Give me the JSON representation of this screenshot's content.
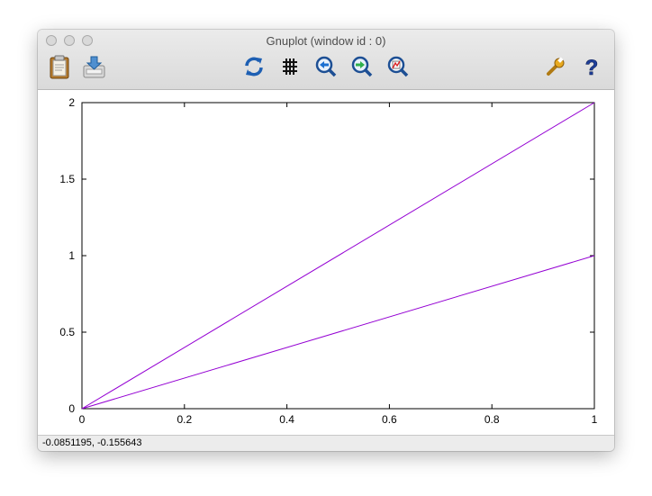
{
  "window": {
    "title": "Gnuplot (window id : 0)"
  },
  "toolbar": {
    "buttons": [
      {
        "name": "copy-to-clipboard-button",
        "icon": "clipboard-icon"
      },
      {
        "name": "export-button",
        "icon": "export-icon"
      },
      {
        "name": "replot-button",
        "icon": "refresh-icon"
      },
      {
        "name": "toggle-grid-button",
        "icon": "grid-icon"
      },
      {
        "name": "zoom-back-button",
        "icon": "zoom-previous-icon"
      },
      {
        "name": "zoom-forward-button",
        "icon": "zoom-next-icon"
      },
      {
        "name": "autoscale-button",
        "icon": "autoscale-icon"
      },
      {
        "name": "settings-button",
        "icon": "wrench-icon"
      },
      {
        "name": "help-button",
        "icon": "help-icon"
      }
    ]
  },
  "status": {
    "coordinates": "-0.0851195, -0.155643"
  },
  "chart_data": {
    "type": "line",
    "title": "",
    "xlabel": "",
    "ylabel": "",
    "xlim": [
      0,
      1
    ],
    "ylim": [
      0,
      2
    ],
    "x_ticks": [
      "0",
      "0.2",
      "0.4",
      "0.6",
      "0.8",
      "1"
    ],
    "y_ticks": [
      "0",
      "0.5",
      "1",
      "1.5",
      "2"
    ],
    "grid": false,
    "line_color": "#9400d3",
    "series": [
      {
        "x": [
          0,
          1
        ],
        "y": [
          0,
          2
        ]
      },
      {
        "x": [
          0,
          1
        ],
        "y": [
          0,
          1
        ]
      }
    ]
  }
}
